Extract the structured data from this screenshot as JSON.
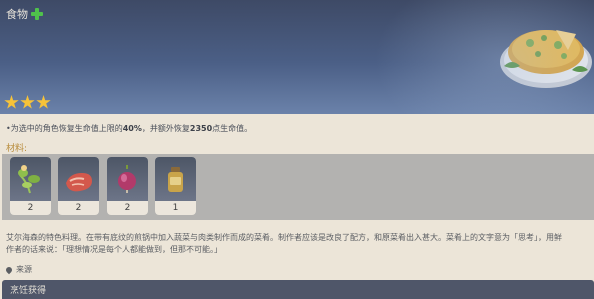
{
  "header": {
    "category": "食物",
    "rarity_stars": 3
  },
  "description": {
    "prefix": "•为选中的角色恢复生命值上限的",
    "percent": "40%",
    "middle": "，并额外恢复",
    "amount": "2350",
    "suffix": "点生命值。"
  },
  "materials": {
    "label": "材料:",
    "items": [
      {
        "icon": "herb-icon",
        "count": "2"
      },
      {
        "icon": "meat-icon",
        "count": "2"
      },
      {
        "icon": "onion-icon",
        "count": "2"
      },
      {
        "icon": "oil-jar-icon",
        "count": "1"
      }
    ]
  },
  "lore": {
    "line1": "艾尔海森的特色料理。在带有底纹的煎锅中加入蔬菜与肉类制作而成的菜肴。制作者应该是改良了配方，和原菜肴出入甚大。菜肴上的文字意为「思考」，用鲜",
    "line2": "作者的话来说：「理想情况是每个人都能做到，但那不可能。」"
  },
  "source": {
    "label": "来源"
  },
  "cook": {
    "label": "烹饪获得"
  },
  "colors": {
    "header_bg": "#4b5f86",
    "star": "#f7c339",
    "materials_label": "#b88c3b",
    "panel_bg": "#ece5d8",
    "cook_bar": "#4f5669"
  }
}
